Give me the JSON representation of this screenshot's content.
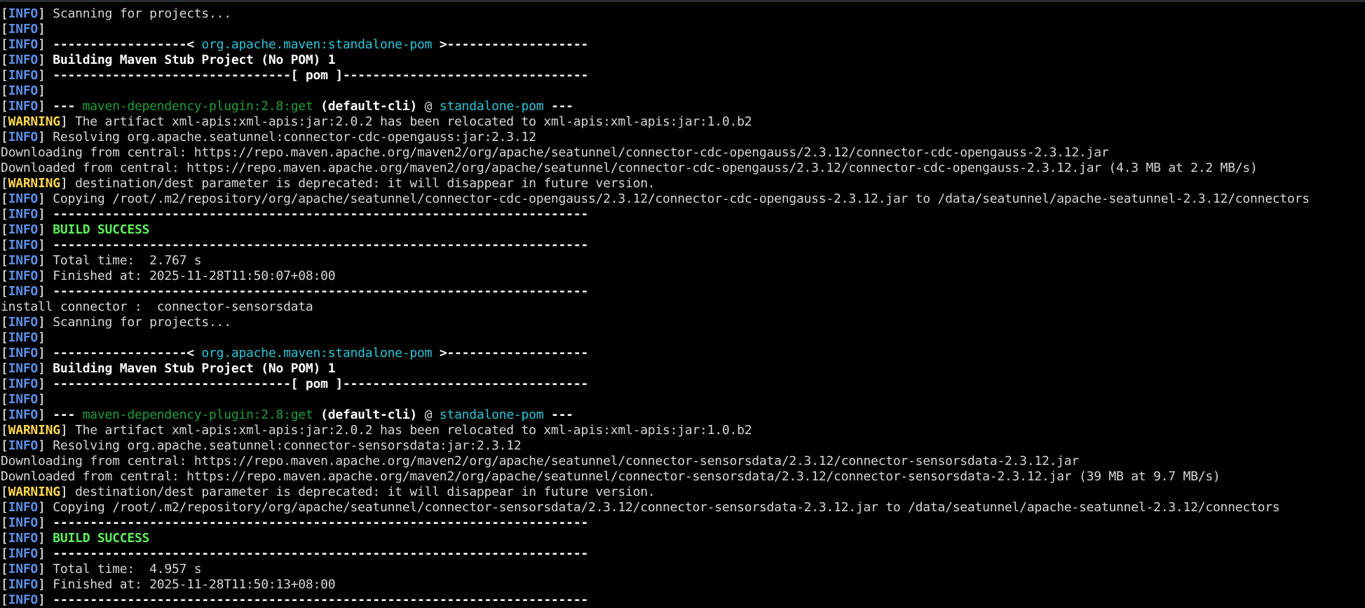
{
  "terminal": {
    "lines": [
      {
        "segments": [
          {
            "t": "[",
            "c": "bracket"
          },
          {
            "t": "INFO",
            "c": "info"
          },
          {
            "t": "] ",
            "c": "bracket"
          },
          {
            "t": "Scanning for projects...",
            "c": "plain"
          }
        ]
      },
      {
        "segments": [
          {
            "t": "[",
            "c": "bracket"
          },
          {
            "t": "INFO",
            "c": "info"
          },
          {
            "t": "]",
            "c": "bracket"
          }
        ]
      },
      {
        "segments": [
          {
            "t": "[",
            "c": "bracket"
          },
          {
            "t": "INFO",
            "c": "info"
          },
          {
            "t": "] ",
            "c": "bracket"
          },
          {
            "t": "------------------< ",
            "c": "bold"
          },
          {
            "t": "org.apache.maven:standalone-pom",
            "c": "cyan"
          },
          {
            "t": " >-------------------",
            "c": "bold"
          }
        ]
      },
      {
        "segments": [
          {
            "t": "[",
            "c": "bracket"
          },
          {
            "t": "INFO",
            "c": "info"
          },
          {
            "t": "] ",
            "c": "bracket"
          },
          {
            "t": "Building Maven Stub Project (No POM) 1",
            "c": "bold"
          }
        ]
      },
      {
        "segments": [
          {
            "t": "[",
            "c": "bracket"
          },
          {
            "t": "INFO",
            "c": "info"
          },
          {
            "t": "] ",
            "c": "bracket"
          },
          {
            "t": "--------------------------------[ pom ]---------------------------------",
            "c": "bold"
          }
        ]
      },
      {
        "segments": [
          {
            "t": "[",
            "c": "bracket"
          },
          {
            "t": "INFO",
            "c": "info"
          },
          {
            "t": "]",
            "c": "bracket"
          }
        ]
      },
      {
        "segments": [
          {
            "t": "[",
            "c": "bracket"
          },
          {
            "t": "INFO",
            "c": "info"
          },
          {
            "t": "] ",
            "c": "bracket"
          },
          {
            "t": "--- ",
            "c": "bold"
          },
          {
            "t": "maven-dependency-plugin:2.8:get",
            "c": "green"
          },
          {
            "t": " (default-cli)",
            "c": "bold"
          },
          {
            "t": " @ ",
            "c": "plain"
          },
          {
            "t": "standalone-pom",
            "c": "cyan"
          },
          {
            "t": " ---",
            "c": "bold"
          }
        ]
      },
      {
        "segments": [
          {
            "t": "[",
            "c": "bracket"
          },
          {
            "t": "WARNING",
            "c": "warn"
          },
          {
            "t": "] ",
            "c": "bracket"
          },
          {
            "t": "The artifact xml-apis:xml-apis:jar:2.0.2 has been relocated to xml-apis:xml-apis:jar:1.0.b2",
            "c": "plain"
          }
        ]
      },
      {
        "segments": [
          {
            "t": "[",
            "c": "bracket"
          },
          {
            "t": "INFO",
            "c": "info"
          },
          {
            "t": "] ",
            "c": "bracket"
          },
          {
            "t": "Resolving org.apache.seatunnel:connector-cdc-opengauss:jar:2.3.12",
            "c": "plain"
          }
        ]
      },
      {
        "segments": [
          {
            "t": "Downloading from central: https://repo.maven.apache.org/maven2/org/apache/seatunnel/connector-cdc-opengauss/2.3.12/connector-cdc-opengauss-2.3.12.jar",
            "c": "plain"
          }
        ]
      },
      {
        "segments": [
          {
            "t": "Downloaded from central: https://repo.maven.apache.org/maven2/org/apache/seatunnel/connector-cdc-opengauss/2.3.12/connector-cdc-opengauss-2.3.12.jar (4.3 MB at 2.2 MB/s)",
            "c": "plain"
          }
        ]
      },
      {
        "segments": [
          {
            "t": "[",
            "c": "bracket"
          },
          {
            "t": "WARNING",
            "c": "warn"
          },
          {
            "t": "] ",
            "c": "bracket"
          },
          {
            "t": "destination/dest parameter is deprecated: it will disappear in future version.",
            "c": "plain"
          }
        ]
      },
      {
        "segments": [
          {
            "t": "[",
            "c": "bracket"
          },
          {
            "t": "INFO",
            "c": "info"
          },
          {
            "t": "] ",
            "c": "bracket"
          },
          {
            "t": "Copying /root/.m2/repository/org/apache/seatunnel/connector-cdc-opengauss/2.3.12/connector-cdc-opengauss-2.3.12.jar to /data/seatunnel/apache-seatunnel-2.3.12/connectors",
            "c": "plain"
          }
        ]
      },
      {
        "segments": [
          {
            "t": "[",
            "c": "bracket"
          },
          {
            "t": "INFO",
            "c": "info"
          },
          {
            "t": "] ",
            "c": "bracket"
          },
          {
            "t": "------------------------------------------------------------------------",
            "c": "bold"
          }
        ]
      },
      {
        "segments": [
          {
            "t": "[",
            "c": "bracket"
          },
          {
            "t": "INFO",
            "c": "info"
          },
          {
            "t": "] ",
            "c": "bracket"
          },
          {
            "t": "BUILD SUCCESS",
            "c": "success"
          }
        ]
      },
      {
        "segments": [
          {
            "t": "[",
            "c": "bracket"
          },
          {
            "t": "INFO",
            "c": "info"
          },
          {
            "t": "] ",
            "c": "bracket"
          },
          {
            "t": "------------------------------------------------------------------------",
            "c": "bold"
          }
        ]
      },
      {
        "segments": [
          {
            "t": "[",
            "c": "bracket"
          },
          {
            "t": "INFO",
            "c": "info"
          },
          {
            "t": "] ",
            "c": "bracket"
          },
          {
            "t": "Total time:  2.767 s",
            "c": "plain"
          }
        ]
      },
      {
        "segments": [
          {
            "t": "[",
            "c": "bracket"
          },
          {
            "t": "INFO",
            "c": "info"
          },
          {
            "t": "] ",
            "c": "bracket"
          },
          {
            "t": "Finished at: 2025-11-28T11:50:07+08:00",
            "c": "plain"
          }
        ]
      },
      {
        "segments": [
          {
            "t": "[",
            "c": "bracket"
          },
          {
            "t": "INFO",
            "c": "info"
          },
          {
            "t": "] ",
            "c": "bracket"
          },
          {
            "t": "------------------------------------------------------------------------",
            "c": "bold"
          }
        ]
      },
      {
        "segments": [
          {
            "t": "install connector :  connector-sensorsdata",
            "c": "plain"
          }
        ]
      },
      {
        "segments": [
          {
            "t": "[",
            "c": "bracket"
          },
          {
            "t": "INFO",
            "c": "info"
          },
          {
            "t": "] ",
            "c": "bracket"
          },
          {
            "t": "Scanning for projects...",
            "c": "plain"
          }
        ]
      },
      {
        "segments": [
          {
            "t": "[",
            "c": "bracket"
          },
          {
            "t": "INFO",
            "c": "info"
          },
          {
            "t": "]",
            "c": "bracket"
          }
        ]
      },
      {
        "segments": [
          {
            "t": "[",
            "c": "bracket"
          },
          {
            "t": "INFO",
            "c": "info"
          },
          {
            "t": "] ",
            "c": "bracket"
          },
          {
            "t": "------------------< ",
            "c": "bold"
          },
          {
            "t": "org.apache.maven:standalone-pom",
            "c": "cyan"
          },
          {
            "t": " >-------------------",
            "c": "bold"
          }
        ]
      },
      {
        "segments": [
          {
            "t": "[",
            "c": "bracket"
          },
          {
            "t": "INFO",
            "c": "info"
          },
          {
            "t": "] ",
            "c": "bracket"
          },
          {
            "t": "Building Maven Stub Project (No POM) 1",
            "c": "bold"
          }
        ]
      },
      {
        "segments": [
          {
            "t": "[",
            "c": "bracket"
          },
          {
            "t": "INFO",
            "c": "info"
          },
          {
            "t": "] ",
            "c": "bracket"
          },
          {
            "t": "--------------------------------[ pom ]---------------------------------",
            "c": "bold"
          }
        ]
      },
      {
        "segments": [
          {
            "t": "[",
            "c": "bracket"
          },
          {
            "t": "INFO",
            "c": "info"
          },
          {
            "t": "]",
            "c": "bracket"
          }
        ]
      },
      {
        "segments": [
          {
            "t": "[",
            "c": "bracket"
          },
          {
            "t": "INFO",
            "c": "info"
          },
          {
            "t": "] ",
            "c": "bracket"
          },
          {
            "t": "--- ",
            "c": "bold"
          },
          {
            "t": "maven-dependency-plugin:2.8:get",
            "c": "green"
          },
          {
            "t": " (default-cli)",
            "c": "bold"
          },
          {
            "t": " @ ",
            "c": "plain"
          },
          {
            "t": "standalone-pom",
            "c": "cyan"
          },
          {
            "t": " ---",
            "c": "bold"
          }
        ]
      },
      {
        "segments": [
          {
            "t": "[",
            "c": "bracket"
          },
          {
            "t": "WARNING",
            "c": "warn"
          },
          {
            "t": "] ",
            "c": "bracket"
          },
          {
            "t": "The artifact xml-apis:xml-apis:jar:2.0.2 has been relocated to xml-apis:xml-apis:jar:1.0.b2",
            "c": "plain"
          }
        ]
      },
      {
        "segments": [
          {
            "t": "[",
            "c": "bracket"
          },
          {
            "t": "INFO",
            "c": "info"
          },
          {
            "t": "] ",
            "c": "bracket"
          },
          {
            "t": "Resolving org.apache.seatunnel:connector-sensorsdata:jar:2.3.12",
            "c": "plain"
          }
        ]
      },
      {
        "segments": [
          {
            "t": "Downloading from central: https://repo.maven.apache.org/maven2/org/apache/seatunnel/connector-sensorsdata/2.3.12/connector-sensorsdata-2.3.12.jar",
            "c": "plain"
          }
        ]
      },
      {
        "segments": [
          {
            "t": "Downloaded from central: https://repo.maven.apache.org/maven2/org/apache/seatunnel/connector-sensorsdata/2.3.12/connector-sensorsdata-2.3.12.jar (39 MB at 9.7 MB/s)",
            "c": "plain"
          }
        ]
      },
      {
        "segments": [
          {
            "t": "[",
            "c": "bracket"
          },
          {
            "t": "WARNING",
            "c": "warn"
          },
          {
            "t": "] ",
            "c": "bracket"
          },
          {
            "t": "destination/dest parameter is deprecated: it will disappear in future version.",
            "c": "plain"
          }
        ]
      },
      {
        "segments": [
          {
            "t": "[",
            "c": "bracket"
          },
          {
            "t": "INFO",
            "c": "info"
          },
          {
            "t": "] ",
            "c": "bracket"
          },
          {
            "t": "Copying /root/.m2/repository/org/apache/seatunnel/connector-sensorsdata/2.3.12/connector-sensorsdata-2.3.12.jar to /data/seatunnel/apache-seatunnel-2.3.12/connectors",
            "c": "plain"
          }
        ]
      },
      {
        "segments": [
          {
            "t": "[",
            "c": "bracket"
          },
          {
            "t": "INFO",
            "c": "info"
          },
          {
            "t": "] ",
            "c": "bracket"
          },
          {
            "t": "------------------------------------------------------------------------",
            "c": "bold"
          }
        ]
      },
      {
        "segments": [
          {
            "t": "[",
            "c": "bracket"
          },
          {
            "t": "INFO",
            "c": "info"
          },
          {
            "t": "] ",
            "c": "bracket"
          },
          {
            "t": "BUILD SUCCESS",
            "c": "success"
          }
        ]
      },
      {
        "segments": [
          {
            "t": "[",
            "c": "bracket"
          },
          {
            "t": "INFO",
            "c": "info"
          },
          {
            "t": "] ",
            "c": "bracket"
          },
          {
            "t": "------------------------------------------------------------------------",
            "c": "bold"
          }
        ]
      },
      {
        "segments": [
          {
            "t": "[",
            "c": "bracket"
          },
          {
            "t": "INFO",
            "c": "info"
          },
          {
            "t": "] ",
            "c": "bracket"
          },
          {
            "t": "Total time:  4.957 s",
            "c": "plain"
          }
        ]
      },
      {
        "segments": [
          {
            "t": "[",
            "c": "bracket"
          },
          {
            "t": "INFO",
            "c": "info"
          },
          {
            "t": "] ",
            "c": "bracket"
          },
          {
            "t": "Finished at: 2025-11-28T11:50:13+08:00",
            "c": "plain"
          }
        ]
      },
      {
        "segments": [
          {
            "t": "[",
            "c": "bracket"
          },
          {
            "t": "INFO",
            "c": "info"
          },
          {
            "t": "] ",
            "c": "bracket"
          },
          {
            "t": "------------------------------------------------------------------------",
            "c": "bold"
          }
        ]
      }
    ]
  },
  "colors": {
    "background": "#000000",
    "info_tag": "#5c8fe6",
    "warning_tag": "#ffd84a",
    "artifact_cyan": "#29c5d8",
    "plugin_green": "#1f9e3a",
    "build_success": "#5cf25c",
    "text": "#d6d6d6"
  }
}
